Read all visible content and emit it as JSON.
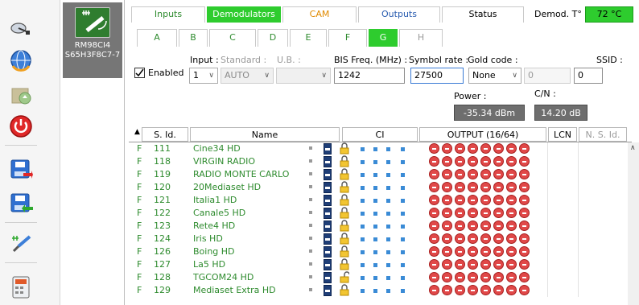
{
  "toolbar": {
    "icons": [
      "satellite-dish-icon",
      "globe-refresh-icon",
      "package-install-icon",
      "power-icon",
      "save-export-icon",
      "save-import-icon",
      "antenna-wand-icon",
      "calculator-icon"
    ]
  },
  "device": {
    "name_line1": "RM98CI4",
    "name_line2": "S65H3F8C7-7"
  },
  "tabs": {
    "main": [
      "Inputs",
      "Demodulators",
      "CAM",
      "Outputs",
      "Status"
    ],
    "active_main": "Demodulators",
    "temp_label": "Demod. T° :",
    "temp_value": "72 °C",
    "sub": [
      "A",
      "B",
      "C",
      "D",
      "E",
      "F",
      "G",
      "H"
    ],
    "active_sub": "G"
  },
  "form": {
    "enabled_label": "Enabled",
    "enabled_checked": true,
    "input_label": "Input :",
    "standard_label": "Standard :",
    "ub_label": "U.B. :",
    "bis_label": "BIS Freq. (MHz) :",
    "symbol_label": "Symbol rate :",
    "gold_label": "Gold code :",
    "ssid_label": "SSID :",
    "input_value": "1",
    "standard_value": "AUTO",
    "ub_value": "",
    "bis_value": "1242",
    "symbol_value": "27500",
    "gold_value": "None",
    "gold_number": "0",
    "ssid_value": "0",
    "power_label": "Power :",
    "power_value": "-35.34 dBm",
    "cn_label": "C/N :",
    "cn_value": "14.20 dB"
  },
  "table": {
    "headers": {
      "sid": "S. Id.",
      "name": "Name",
      "ci": "CI",
      "output": "OUTPUT (16/64)",
      "lcn": "LCN",
      "nsid": "N. S. Id."
    },
    "rows": [
      {
        "flag": "F",
        "sid": "111",
        "name": "Cine34 HD",
        "open_lock": false
      },
      {
        "flag": "F",
        "sid": "118",
        "name": "VIRGIN RADIO",
        "open_lock": false
      },
      {
        "flag": "F",
        "sid": "119",
        "name": "RADIO MONTE CARLO",
        "open_lock": false
      },
      {
        "flag": "F",
        "sid": "120",
        "name": "20Mediaset HD",
        "open_lock": false
      },
      {
        "flag": "F",
        "sid": "121",
        "name": "Italia1 HD",
        "open_lock": false
      },
      {
        "flag": "F",
        "sid": "122",
        "name": "Canale5 HD",
        "open_lock": false
      },
      {
        "flag": "F",
        "sid": "123",
        "name": "Rete4 HD",
        "open_lock": false
      },
      {
        "flag": "F",
        "sid": "124",
        "name": "Iris HD",
        "open_lock": false
      },
      {
        "flag": "F",
        "sid": "126",
        "name": "Boing HD",
        "open_lock": false
      },
      {
        "flag": "F",
        "sid": "127",
        "name": "La5 HD",
        "open_lock": false
      },
      {
        "flag": "F",
        "sid": "128",
        "name": "TGCOM24 HD",
        "open_lock": true
      },
      {
        "flag": "F",
        "sid": "129",
        "name": "Mediaset Extra HD",
        "open_lock": false
      }
    ]
  },
  "colors": {
    "accent_green": "#2ecc2e",
    "text_green": "#2e8b2e",
    "output_red": "#e04848",
    "ci_blue": "#3a8bd6"
  }
}
